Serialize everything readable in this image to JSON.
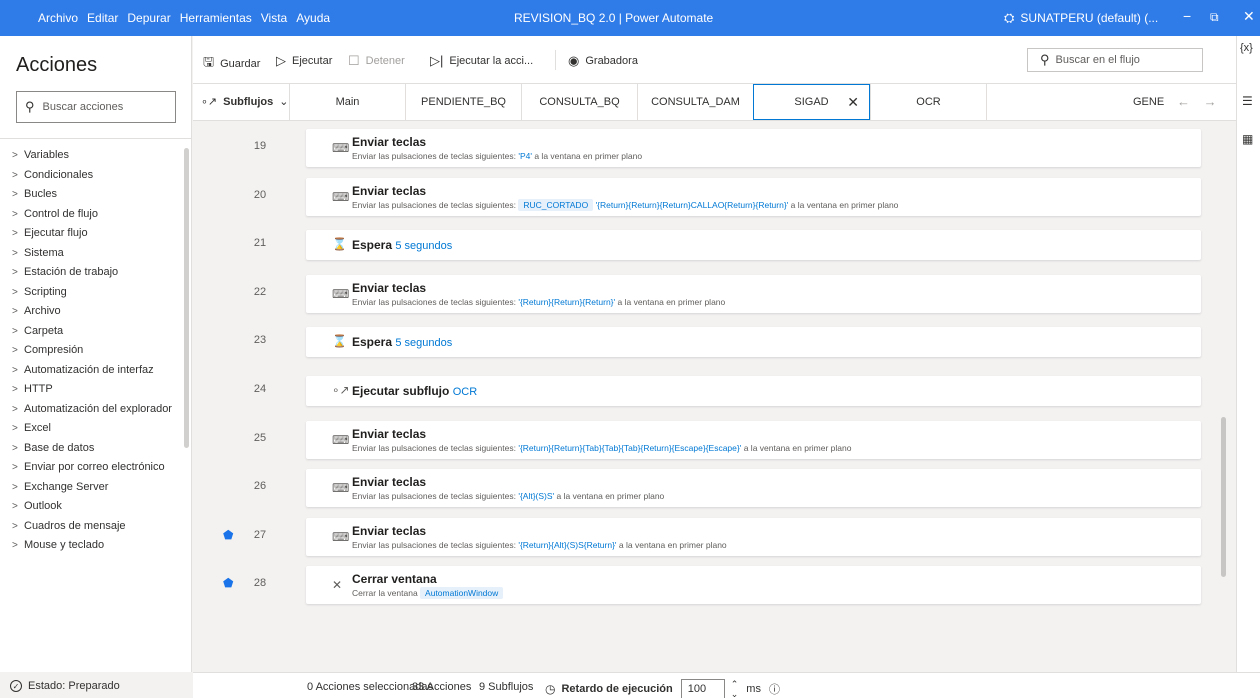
{
  "titlebar": {
    "menu": [
      "Archivo",
      "Editar",
      "Depurar",
      "Herramientas",
      "Vista",
      "Ayuda"
    ],
    "title": "REVISION_BQ 2.0 | Power Automate",
    "account": "SUNATPERU (default) (...",
    "minimize": "−",
    "restore": "⧉",
    "close": "✕"
  },
  "actions_panel": {
    "title": "Acciones",
    "search_placeholder": "Buscar acciones",
    "categories": [
      "Variables",
      "Condicionales",
      "Bucles",
      "Control de flujo",
      "Ejecutar flujo",
      "Sistema",
      "Estación de trabajo",
      "Scripting",
      "Archivo",
      "Carpeta",
      "Compresión",
      "Automatización de interfaz",
      "HTTP",
      "Automatización del explorador",
      "Excel",
      "Base de datos",
      "Enviar por correo electrónico",
      "Exchange Server",
      "Outlook",
      "Cuadros de mensaje",
      "Mouse y teclado"
    ]
  },
  "toolbar": {
    "save": "Guardar",
    "run": "Ejecutar",
    "stop": "Detener",
    "run_action": "Ejecutar la acci...",
    "recorder": "Grabadora",
    "flow_search_placeholder": "Buscar en el flujo"
  },
  "tabs": {
    "subflows_label": "Subflujos",
    "items": [
      "Main",
      "PENDIENTE_BQ",
      "CONSULTA_BQ",
      "CONSULTA_DAM",
      "SIGAD",
      "OCR",
      "GENE"
    ],
    "active": "SIGAD"
  },
  "steps": [
    {
      "n": "19",
      "title": "Enviar teclas",
      "desc_pre": "Enviar las pulsaciones de teclas siguientes: ",
      "hl": "'P4'",
      "desc_post": " a la ventana en primer plano",
      "breakpoint": false
    },
    {
      "n": "20",
      "title": "Enviar teclas",
      "desc_pre": "Enviar las pulsaciones de teclas siguientes: ",
      "pill": "RUC_CORTADO",
      "hl": "'{Return}{Return}{Return}CALLAO{Return}{Return}'",
      "desc_post": " a la ventana en primer plano",
      "breakpoint": false
    },
    {
      "n": "21",
      "title": "Espera",
      "suffix": "5 segundos",
      "breakpoint": false
    },
    {
      "n": "22",
      "title": "Enviar teclas",
      "desc_pre": "Enviar las pulsaciones de teclas siguientes: ",
      "hl": "'{Return}{Return}{Return}'",
      "desc_post": " a la ventana en primer plano",
      "breakpoint": false
    },
    {
      "n": "23",
      "title": "Espera",
      "suffix": "5 segundos",
      "breakpoint": false
    },
    {
      "n": "24",
      "title": "Ejecutar subflujo",
      "suffix": "OCR",
      "breakpoint": false
    },
    {
      "n": "25",
      "title": "Enviar teclas",
      "desc_pre": "Enviar las pulsaciones de teclas siguientes: ",
      "hl": "'{Return}{Return}{Tab}{Tab}{Tab}{Return}{Escape}{Escape}'",
      "desc_post": " a la ventana en primer plano",
      "breakpoint": false
    },
    {
      "n": "26",
      "title": "Enviar teclas",
      "desc_pre": "Enviar las pulsaciones de teclas siguientes: ",
      "hl": "'{Alt}(S)S'",
      "desc_post": " a la ventana en primer plano",
      "breakpoint": false
    },
    {
      "n": "27",
      "title": "Enviar teclas",
      "desc_pre": "Enviar las pulsaciones de teclas siguientes: ",
      "hl": "'{Return}{Alt}(S)S{Return}'",
      "desc_post": " a la ventana en primer plano",
      "breakpoint": true
    },
    {
      "n": "28",
      "title": "Cerrar ventana",
      "desc_pre": "Cerrar la ventana ",
      "pill": "AutomationWindow",
      "desc_post": "",
      "breakpoint": true
    }
  ],
  "statusbar": {
    "state": "Estado: Preparado",
    "selected": "0 Acciones seleccionadas",
    "actions": "33 Acciones",
    "subflows": "9 Subflujos",
    "delay_label": "Retardo de ejecución",
    "delay_value": "100",
    "delay_unit": "ms"
  },
  "right_rail": {
    "variables": "{x}"
  }
}
